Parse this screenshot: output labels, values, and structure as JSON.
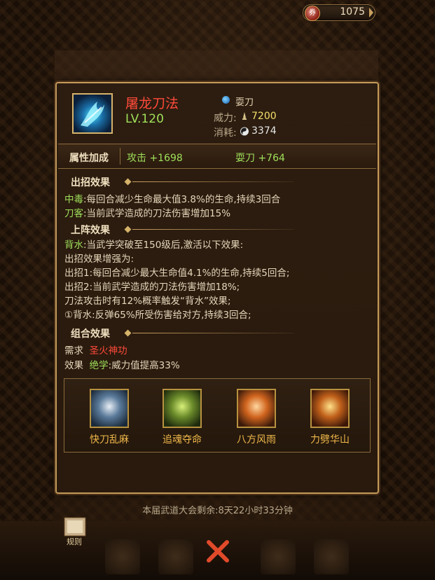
{
  "currency": {
    "value": "1075",
    "icon": "red-coin-icon"
  },
  "skill": {
    "name": "屠龙刀法",
    "level": "LV.120",
    "weapon_type": "耍刀",
    "power_label": "威力:",
    "power_value": "7200",
    "cost_label": "消耗:",
    "cost_value": "3374"
  },
  "attributes": {
    "title": "属性加成",
    "attack": "攻击 +1698",
    "blade": "耍刀 +764"
  },
  "move_effects": {
    "title": "出招效果",
    "l1_key": "中毒",
    "l1_text": ":每回合减少生命最大值3.8%的生命,持续3回合",
    "l2_key": "刀客",
    "l2_text": ":当前武学造成的刀法伤害增加15%"
  },
  "formation_effects": {
    "title": "上阵效果",
    "l1_key": "背水",
    "l1_text": ":当武学突破至150级后,激活以下效果:",
    "l2": "出招效果增强为:",
    "l3": "出招1:每回合减少最大生命值4.1%的生命,持续5回合;",
    "l4": "出招2:当前武学造成的刀法伤害增加18%;",
    "l5": "刀法攻击时有12%概率触发“背水”效果;",
    "l6": "①背水:反弹65%所受伤害给对方,持续3回合;"
  },
  "combo_effects": {
    "title": "组合效果",
    "req_label": "需求",
    "req_value": "圣火神功",
    "eff_label": "效果",
    "eff_key": "绝学",
    "eff_text": ":威力值提高33%"
  },
  "combo_skills": [
    {
      "name": "快刀乱麻"
    },
    {
      "name": "追魂夺命"
    },
    {
      "name": "八方风雨"
    },
    {
      "name": "力劈华山"
    }
  ],
  "footer": {
    "tournament": "本届武道大会剩余:8天22小时33分钟",
    "rules_label": "规则"
  }
}
